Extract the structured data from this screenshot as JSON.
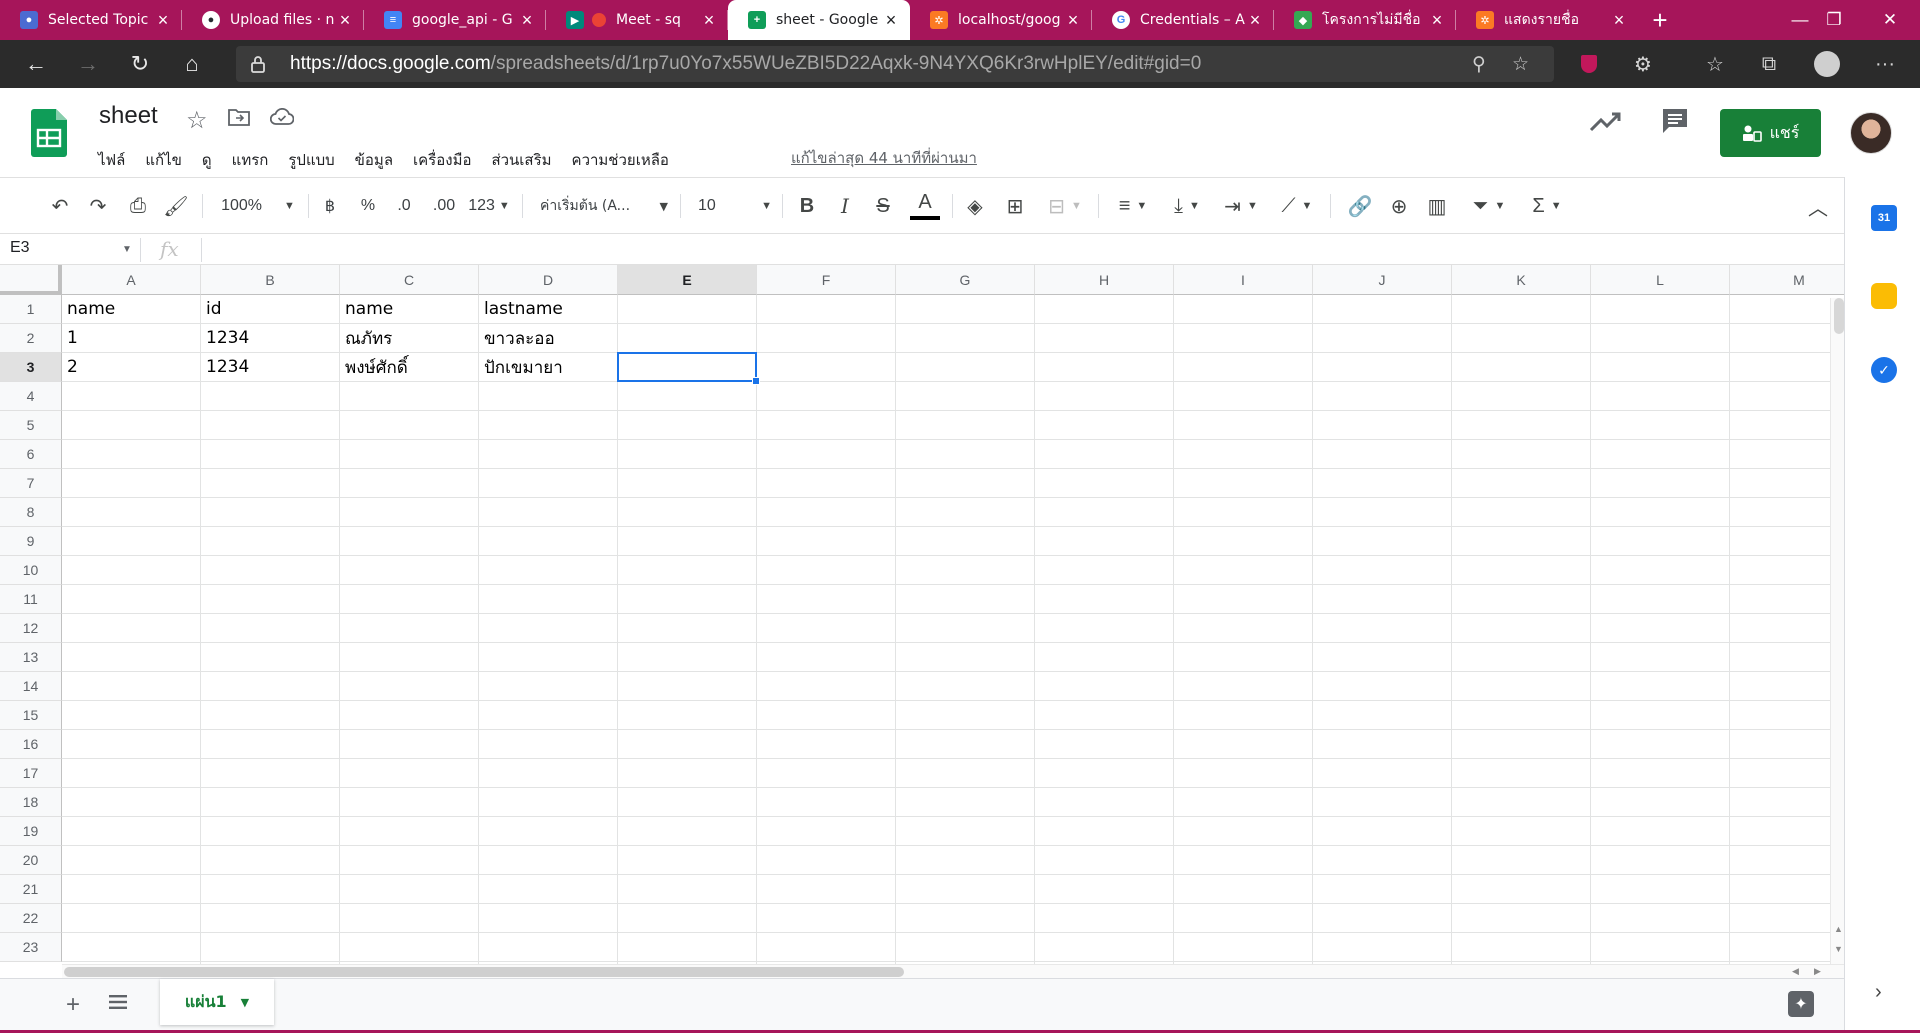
{
  "browser": {
    "tabs": [
      {
        "title": "Selected Topic",
        "favicon_color": "#4b6bd1"
      },
      {
        "title": "Upload files · n",
        "favicon_color": "#24292e"
      },
      {
        "title": "google_api - G",
        "favicon_color": "#4285f4"
      },
      {
        "title": "Meet - sq",
        "favicon_color": "#00897b"
      },
      {
        "title": "sheet - Google",
        "favicon_color": "#0f9d58",
        "active": true
      },
      {
        "title": "localhost/goog",
        "favicon_color": "#fb7a24"
      },
      {
        "title": "Credentials – A",
        "favicon_color": "#4285f4"
      },
      {
        "title": "โครงการไม่มีชื่อ",
        "favicon_color": "#34a853"
      },
      {
        "title": "แสดงรายชื่อ",
        "favicon_color": "#fb7a24"
      }
    ],
    "url_host": "https://docs.google.com",
    "url_path": "/spreadsheets/d/1rp7u0Yo7x55WUeZBI5D22Aqxk-9N4YXQ6Kr3rwHplEY/edit#gid=0",
    "tab_strip_color": "#a6155a"
  },
  "doc": {
    "title": "sheet",
    "menu": [
      "ไฟล์",
      "แก้ไข",
      "ดู",
      "แทรก",
      "รูปแบบ",
      "ข้อมูล",
      "เครื่องมือ",
      "ส่วนเสริม",
      "ความช่วยเหลือ"
    ],
    "last_edit": "แก้ไขล่าสุด 44 นาทีที่ผ่านมา",
    "share_label": "แชร์",
    "accent": "#188038"
  },
  "toolbar": {
    "zoom": "100%",
    "currency": "฿",
    "percent": "%",
    "dec_decrease": ".0",
    "dec_increase": ".00",
    "more_formats": "123",
    "font": "ค่าเริ่มต้น (A...",
    "font_size": "10"
  },
  "formula": {
    "name_box": "E3",
    "fx": "fx"
  },
  "grid": {
    "columns": [
      "A",
      "B",
      "C",
      "D",
      "E",
      "F",
      "G",
      "H",
      "I",
      "J",
      "K",
      "L",
      "M"
    ],
    "selected_column": "E",
    "rows": [
      "1",
      "2",
      "3",
      "4",
      "5",
      "6",
      "7",
      "8",
      "9",
      "10",
      "11",
      "12",
      "13",
      "14",
      "15",
      "16",
      "17",
      "18",
      "19",
      "20",
      "21",
      "22",
      "23"
    ],
    "selected_row": "3",
    "cells": [
      [
        "name",
        "id",
        "name",
        "lastname"
      ],
      [
        "1",
        "1234",
        "ณภัทร",
        "ขาวละออ"
      ],
      [
        "2",
        "1234",
        "พงษ์ศักดิ์",
        "ปักเขมายา"
      ]
    ],
    "active_cell": "E3"
  },
  "sheets": {
    "tabs": [
      "แผ่น1"
    ]
  }
}
